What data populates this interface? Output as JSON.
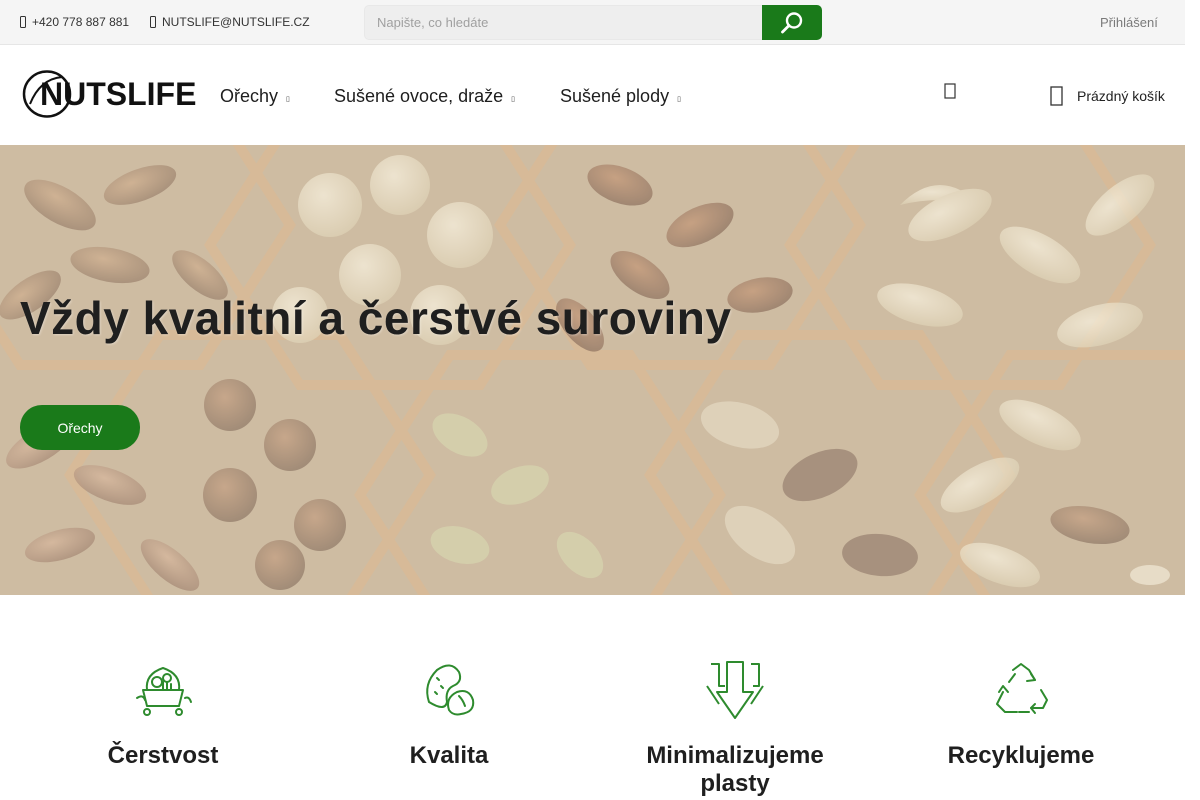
{
  "topbar": {
    "phone": "+420 778 887 881",
    "email": "NUTSLIFE@NUTSLIFE.CZ",
    "search_placeholder": "Napište, co hledáte",
    "login_label": "Přihlášení"
  },
  "header": {
    "logo_text": "NUTSLIFE",
    "nav": [
      {
        "label": "Ořechy"
      },
      {
        "label": "Sušené ovoce, draže"
      },
      {
        "label": "Sušené plody"
      }
    ],
    "cart_label": "Prázdný košík"
  },
  "hero": {
    "title": "Vždy kvalitní a čerstvé suroviny",
    "button_label": "Ořechy"
  },
  "features": [
    {
      "title": "Čerstvost",
      "icon": "fresh-basket-icon"
    },
    {
      "title": "Kvalita",
      "icon": "nuts-quality-icon"
    },
    {
      "title": "Minimalizujeme plasty",
      "icon": "arrows-down-icon"
    },
    {
      "title": "Recyklujeme",
      "icon": "recycle-icon"
    }
  ],
  "colors": {
    "brand_green": "#1a7a1a",
    "icon_green": "#2e8b2e",
    "topbar_bg": "#f5f5f5"
  }
}
